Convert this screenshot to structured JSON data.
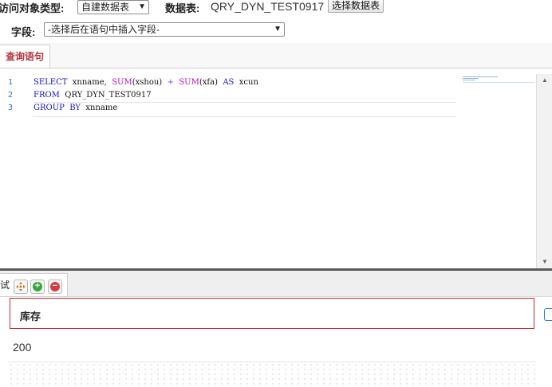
{
  "form": {
    "access_type_label": "访问对象类型:",
    "access_type_value": "自建数据表",
    "table_label": "数据表:",
    "table_value": "QRY_DYN_TEST0917",
    "select_table_button": "选择数据表",
    "field_label": "字段:",
    "field_placeholder": "-选择后在语句中插入字段-"
  },
  "tabs": {
    "query_tab": "查询语句"
  },
  "editor": {
    "lines": [
      {
        "no": "1"
      },
      {
        "no": "2"
      },
      {
        "no": "3"
      }
    ],
    "line1": {
      "kw1": "SELECT",
      "t1": "xnname,",
      "fn1": "SUM",
      "t2": "(xshou)",
      "op": "+",
      "fn2": "SUM",
      "t3": "(xfa)",
      "kw2": "AS",
      "t4": "xcun"
    },
    "line2": {
      "kw1": "FROM",
      "t1": "QRY_DYN_TEST0917"
    },
    "line3": {
      "kw1": "GROUP",
      "kw2": "BY",
      "t1": "xnname"
    }
  },
  "lower": {
    "partial_tab_label": "试",
    "toolbar_icons": [
      "move-icon",
      "add-icon",
      "remove-icon"
    ]
  },
  "result": {
    "column_header": "库存",
    "rows": [
      "200"
    ]
  },
  "colors": {
    "keyword": "#1414c8",
    "function": "#b414b4",
    "tab_active_text": "#b5343d",
    "header_border": "#c8252c"
  }
}
